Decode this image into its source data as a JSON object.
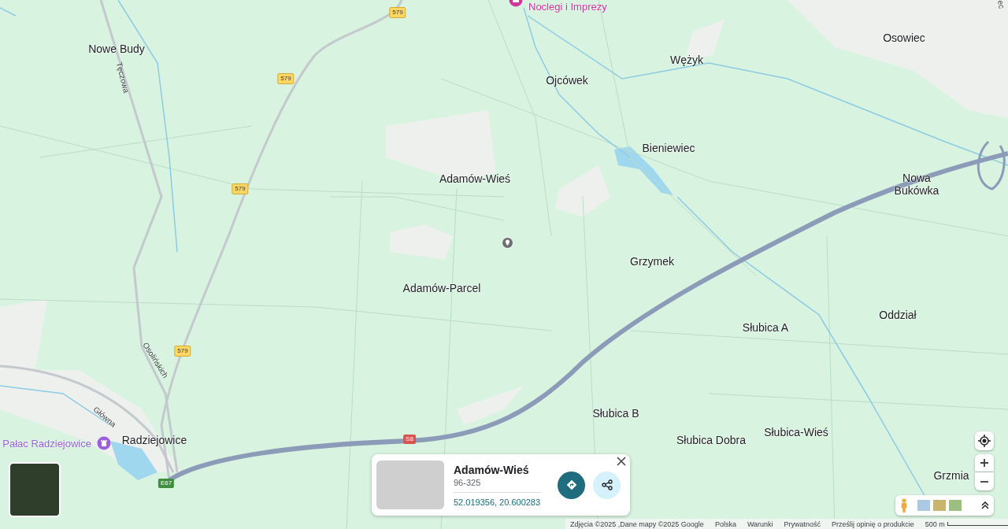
{
  "places": [
    {
      "text": "Osowiec"
    },
    {
      "text": "Nowe Budy"
    },
    {
      "text": "Wężyk"
    },
    {
      "text": "Ojcówek"
    },
    {
      "text": "Bieniewiec"
    },
    {
      "text": "Adamów-Wieś"
    },
    {
      "text": "Nowa Bukówka"
    },
    {
      "text": "Grzymek"
    },
    {
      "text": "Adamów-Parcel"
    },
    {
      "text": "Oddział"
    },
    {
      "text": "Słubica A"
    },
    {
      "text": "Słubica B"
    },
    {
      "text": "Słubica-Wieś"
    },
    {
      "text": "Radziejowice"
    },
    {
      "text": "Słubica Dobra"
    },
    {
      "text": "Grzmia"
    }
  ],
  "pois": [
    {
      "text": "Noclegi i Imprezy",
      "kind": "lodging",
      "color": "#d6339e"
    },
    {
      "text": "Pałac Radziejowice",
      "kind": "landmark",
      "color": "#9c5fe0"
    }
  ],
  "streets": [
    {
      "text": "Tęczowa"
    },
    {
      "text": "Osolińskich"
    },
    {
      "text": "Główna"
    },
    {
      "text": "ec"
    }
  ],
  "road_shields": [
    {
      "text": "579",
      "kind": "regional"
    },
    {
      "text": "579",
      "kind": "regional"
    },
    {
      "text": "579",
      "kind": "regional"
    },
    {
      "text": "579",
      "kind": "regional"
    },
    {
      "text": "S8",
      "kind": "expressway"
    },
    {
      "text": "E67",
      "kind": "european"
    }
  ],
  "place_card": {
    "title": "Adamów-Wieś",
    "postcode": "96-325",
    "coordinates": "52.019356, 20.600283"
  },
  "footer": {
    "links": [
      "Zdjęcia ©2025 ,Dane mapy ©2025 Google",
      "Polska",
      "Warunki",
      "Prywatność",
      "Prześlij opinię o produkcie"
    ],
    "scale": "500 m"
  }
}
